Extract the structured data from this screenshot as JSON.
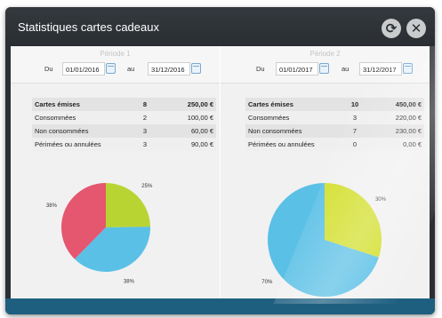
{
  "window": {
    "title": "Statistiques cartes cadeaux",
    "refresh_icon": "refresh-icon",
    "close_icon": "close-icon"
  },
  "labels": {
    "from": "Du",
    "to": "au"
  },
  "periods": [
    {
      "title": "Période 1",
      "from_date": "01/01/2016",
      "to_date": "31/12/2016",
      "rows": [
        {
          "label": "Cartes émises",
          "count": "8",
          "amount": "250,00 €"
        },
        {
          "label": "Consommées",
          "count": "2",
          "amount": "100,00 €"
        },
        {
          "label": "Non consommées",
          "count": "3",
          "amount": "60,00 €"
        },
        {
          "label": "Périmées ou annulées",
          "count": "3",
          "amount": "90,00 €"
        }
      ]
    },
    {
      "title": "Période 2",
      "from_date": "01/01/2017",
      "to_date": "31/12/2017",
      "rows": [
        {
          "label": "Cartes émises",
          "count": "10",
          "amount": "450,00 €"
        },
        {
          "label": "Consommées",
          "count": "3",
          "amount": "220,00 €"
        },
        {
          "label": "Non consommées",
          "count": "7",
          "amount": "230,00 €"
        },
        {
          "label": "Périmées ou annulées",
          "count": "0",
          "amount": "0,00 €"
        }
      ]
    }
  ],
  "colors": {
    "green": "#b8d433",
    "blue": "#5bc0e6",
    "red": "#e5566f",
    "accent_bar": "#1e5f80"
  },
  "chart_data": [
    {
      "type": "pie",
      "slices": [
        {
          "value": 25,
          "label": "25%",
          "color": "#b8d433"
        },
        {
          "value": 38,
          "label": "38%",
          "color": "#5bc0e6"
        },
        {
          "value": 38,
          "label": "38%",
          "color": "#e5566f"
        }
      ]
    },
    {
      "type": "pie",
      "slices": [
        {
          "value": 30,
          "label": "30%",
          "color": "#d3df2c"
        },
        {
          "value": 70,
          "label": "70%",
          "color": "#5bc0e6"
        }
      ]
    }
  ]
}
